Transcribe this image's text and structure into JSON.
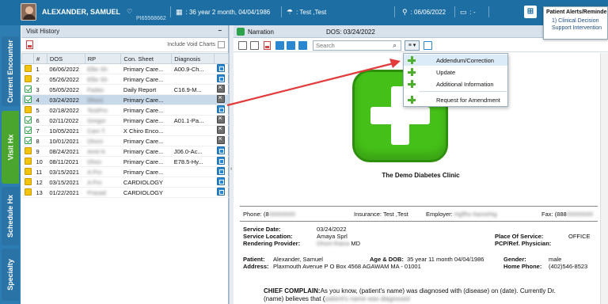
{
  "header": {
    "patient_name": "ALEXANDER, SAMUEL",
    "patient_id": "PI65568662",
    "age_dob": ": 36 year 2 month, 04/04/1986",
    "insurance": ": Test ,Test",
    "visit_date": ": 06/06/2022",
    "extra": ": -",
    "alerts_title": "Patient Alerts/Reminde",
    "alerts_line1": "1) Clinical Decision",
    "alerts_line2": "Support Intervention"
  },
  "side_tabs": [
    "Current Encounter",
    "Visit Hx",
    "Schedule Hx",
    "Specialty"
  ],
  "visit_history": {
    "title": "Visit History",
    "void_label": "Include Void Charts",
    "columns": [
      "#",
      "DOS",
      "RP",
      "Con. Sheet",
      "Diagnosis"
    ],
    "rows": [
      {
        "n": "1",
        "dos": "06/06/2022",
        "rp": "Ellie Sh",
        "sheet": "Primary Care...",
        "dx": "A00.9-Ch...",
        "status": "pending",
        "action": "edit"
      },
      {
        "n": "2",
        "dos": "05/26/2022",
        "rp": "Ellie Sh",
        "sheet": "Primary Care...",
        "dx": "",
        "status": "pending",
        "action": "edit"
      },
      {
        "n": "3",
        "dos": "05/05/2022",
        "rp": "Fadas",
        "sheet": "Daily Report",
        "dx": "C16.9-M...",
        "status": "done",
        "action": "lock"
      },
      {
        "n": "4",
        "dos": "03/24/2022",
        "rp": "Dhoni",
        "sheet": "Primary Care...",
        "dx": "",
        "status": "done",
        "action": "lock"
      },
      {
        "n": "5",
        "dos": "02/18/2022",
        "rp": "TestPro",
        "sheet": "Primary Care...",
        "dx": "",
        "status": "pending",
        "action": "edit"
      },
      {
        "n": "6",
        "dos": "02/11/2022",
        "rp": "Gregor",
        "sheet": "Primary Care...",
        "dx": "A01.1-Pa...",
        "status": "done",
        "action": "lock"
      },
      {
        "n": "7",
        "dos": "10/05/2021",
        "rp": "Cam T.",
        "sheet": "X Chiro Enco...",
        "dx": "",
        "status": "done",
        "action": "lock"
      },
      {
        "n": "8",
        "dos": "10/01/2021",
        "rp": "Dhoni",
        "sheet": "Primary Care...",
        "dx": "",
        "status": "done",
        "action": "lock"
      },
      {
        "n": "9",
        "dos": "08/24/2021",
        "rp": "Amit N",
        "sheet": "Primary Care...",
        "dx": "J06.0-Ac...",
        "status": "pending",
        "action": "edit"
      },
      {
        "n": "10",
        "dos": "08/11/2021",
        "rp": "Dhon",
        "sheet": "Primary Care...",
        "dx": "E78.5-Hy...",
        "status": "pending",
        "action": "edit"
      },
      {
        "n": "11",
        "dos": "03/15/2021",
        "rp": "A Pro",
        "sheet": "Primary Care...",
        "dx": "",
        "status": "pending",
        "action": "edit"
      },
      {
        "n": "12",
        "dos": "03/15/2021",
        "rp": "A Pro",
        "sheet": "CARDIOLOGY",
        "dx": "",
        "status": "pending",
        "action": "edit"
      },
      {
        "n": "13",
        "dos": "01/22/2021",
        "rp": "Prasad",
        "sheet": "CARDIOLOGY",
        "dx": "",
        "status": "pending",
        "action": "edit"
      }
    ]
  },
  "narration": {
    "title": "Narration",
    "dos": "DOS: 03/24/2022",
    "search_placeholder": "Search",
    "menu_items": [
      "Addendum/Correction",
      "Update",
      "Additional Information",
      "Request for Amendment"
    ]
  },
  "document": {
    "clinic": "The Demo Diabetes Clinic",
    "phone_label": "Phone:",
    "phone_prefix": "(8",
    "insurance_label": "Insurance:",
    "insurance_val": "Test ,Test",
    "employer_label": "Employer:",
    "fax_label": "Fax:",
    "fax_prefix": "(888",
    "service_date_label": "Service Date:",
    "service_date": "03/24/2022",
    "service_location_label": "Service Location:",
    "service_location": "Amaya Sprl",
    "rendering_label": "Rendering Provider:",
    "rendering_suffix": "MD",
    "pos_label": "Place Of Service:",
    "pos": "OFFICE",
    "pcp_label": "PCP/Ref. Physician:",
    "patient_label": "Patient:",
    "patient": "Alexander, Samuel",
    "agedob_label": "Age & DOB:",
    "agedob": "35 year 11 month  04/04/1986",
    "gender_label": "Gender:",
    "gender": "male",
    "address_label": "Address:",
    "address": "Plaxmouth Avenue P O Box 4568   AGAWAM  MA - 01001",
    "homephone_label": "Home Phone:",
    "homephone": "(402)546-8523",
    "cc_label": "CHIEF COMPLAIN:",
    "cc_text1": "As you know, (patient's name) was diagnosed with (disease) on (date). Currently Dr.",
    "cc_text2": "(name) believes that ("
  },
  "colors": {
    "header": "#1d6fa3",
    "accent_green": "#4daf2d",
    "arrow": "#e33b3b"
  }
}
